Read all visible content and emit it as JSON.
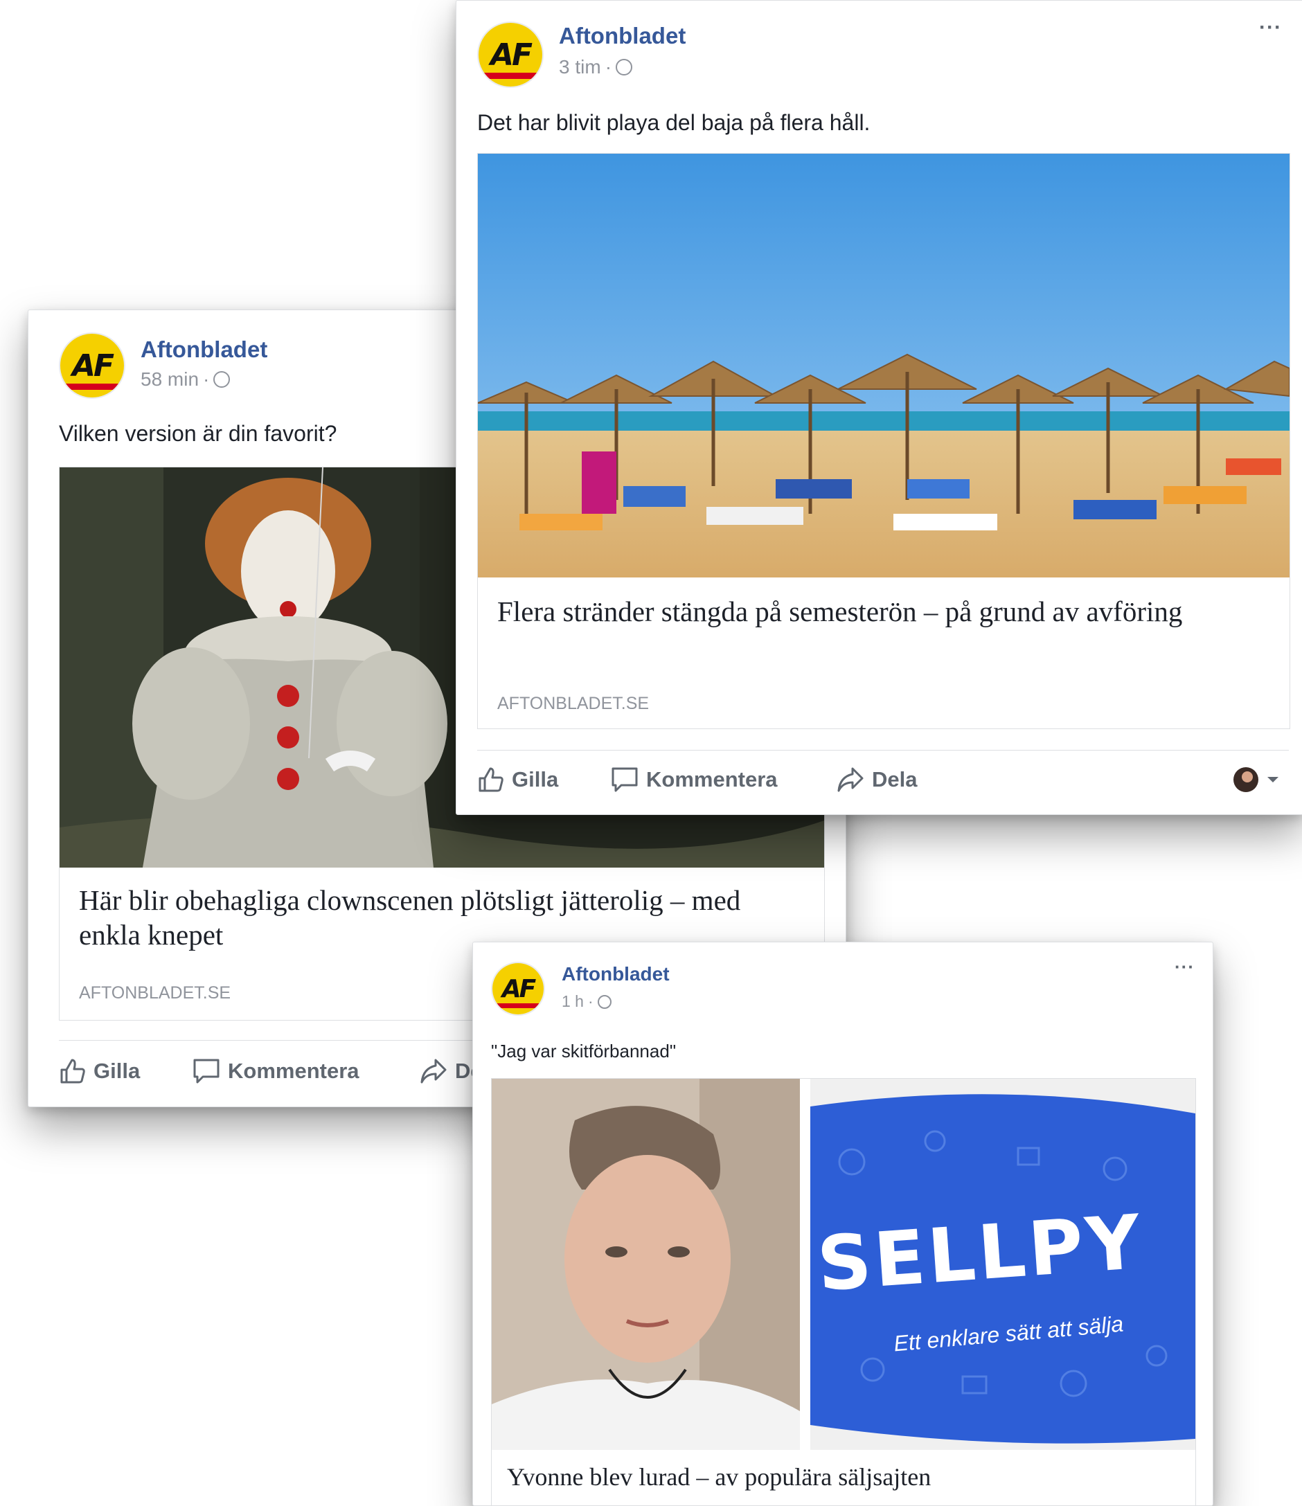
{
  "colors": {
    "page_name": "#365899",
    "meta_gray": "#90949c",
    "action_gray": "#606770",
    "logo_yellow": "#f5d000",
    "logo_red": "#d6001c"
  },
  "icons": [
    "aftonbladet-logo-icon",
    "globe-icon",
    "more-icon",
    "like-icon",
    "comment-icon",
    "share-icon",
    "avatar-icon",
    "chevron-down-icon"
  ],
  "post_it": {
    "page_name": "Aftonbladet",
    "time": "58 min",
    "status": "Vilken version är din favorit?",
    "link_title": "Här blir obehagliga clownscenen plötsligt jätterolig – med enkla knepet",
    "link_domain": "AFTONBLADET.SE",
    "actions": {
      "like": "Gilla",
      "comment": "Kommentera",
      "share": "Dela"
    }
  },
  "post_beach": {
    "page_name": "Aftonbladet",
    "time": "3 tim",
    "status": "Det har blivit playa del baja på flera håll.",
    "link_title": "Flera stränder stängda på semesterön – på grund av avföring",
    "link_domain": "AFTONBLADET.SE",
    "actions": {
      "like": "Gilla",
      "comment": "Kommentera",
      "share": "Dela"
    }
  },
  "post_sellpy": {
    "page_name": "Aftonbladet",
    "time": "1 h",
    "status": "\"Jag var skitförbannad\"",
    "link_title": "Yvonne blev lurad – av populära säljsajten",
    "bag_brand": "SELLPY",
    "bag_slogan": "Ett enklare sätt att sälja"
  },
  "logo_text": "AF"
}
